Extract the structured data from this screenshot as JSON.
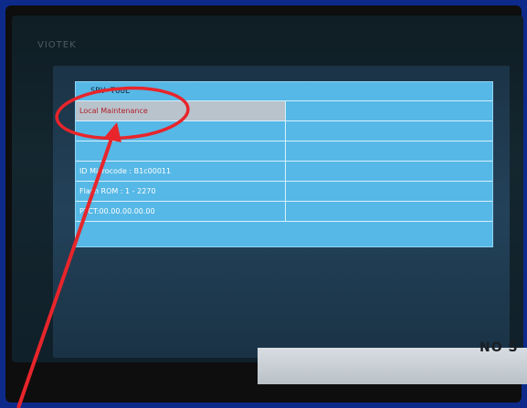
{
  "brand": "VIOTEK",
  "tool": {
    "title": "SRV-TOOL",
    "rows": [
      {
        "label": "Local Maintenance",
        "selected": true
      },
      {
        "label": ""
      },
      {
        "label": ""
      },
      {
        "label": "ID Microcode : B1c00011"
      },
      {
        "label": "Flash ROM : 1 - 2270"
      },
      {
        "label": "PTCT:00.00.00.00.00"
      }
    ]
  },
  "corner_text": "NO S",
  "colors": {
    "annotation": "#e8252b",
    "menu_bg": "#56b8e6",
    "highlight_bg": "#b9c3cc"
  }
}
